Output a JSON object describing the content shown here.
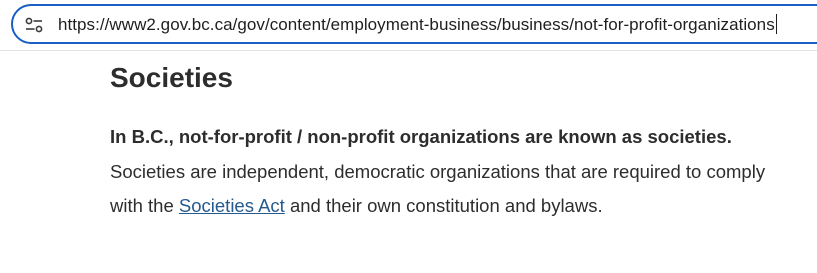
{
  "browser": {
    "url": "https://www2.gov.bc.ca/gov/content/employment-business/business/not-for-profit-organizations",
    "site_info_icon": "tune-icon",
    "focus_color": "#1a5fc7"
  },
  "page": {
    "title": "Societies",
    "intro": {
      "bold_text": "In B.C., not-for-profit / non-profit organizations are known as societies.",
      "text_before_link": " Societies are independent, democratic organizations that are required to comply with the ",
      "link_text": "Societies Act",
      "text_after_link": " and their own constitution and bylaws."
    },
    "link_color": "#255a90",
    "text_color": "#2d2d2d"
  }
}
